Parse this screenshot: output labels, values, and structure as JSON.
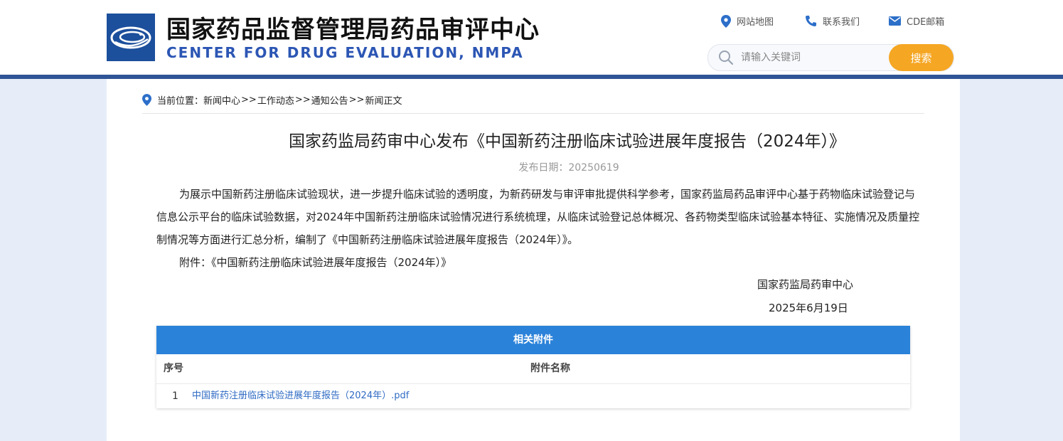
{
  "header": {
    "title_cn": "国家药品监督管理局药品审评中心",
    "title_en": "CENTER FOR DRUG EVALUATION, NMPA",
    "links": [
      {
        "label": "网站地图",
        "icon": "location-pin-icon"
      },
      {
        "label": "联系我们",
        "icon": "phone-icon"
      },
      {
        "label": "CDE邮箱",
        "icon": "mail-icon"
      }
    ],
    "search": {
      "placeholder": "请输入关键词",
      "button_label": "搜索"
    }
  },
  "breadcrumb": {
    "prefix": "当前位置：",
    "items": [
      "新闻中心",
      "工作动态",
      "通知公告",
      "新闻正文"
    ],
    "separator": ">>"
  },
  "article": {
    "title": "国家药监局药审中心发布《中国新药注册临床试验进展年度报告（2024年）》",
    "date": "发布日期：20250619",
    "paragraph": "为展示中国新药注册临床试验现状，进一步提升临床试验的透明度，为新药研发与审评审批提供科学参考，国家药监局药品审评中心基于药物临床试验登记与信息公示平台的临床试验数据，对2024年中国新药注册临床试验情况进行系统梳理，从临床试验登记总体概况、各药物类型临床试验基本特征、实施情况及质量控制情况等方面进行汇总分析，编制了《中国新药注册临床试验进展年度报告（2024年）》。",
    "attachment_line": "附件：《中国新药注册临床试验进展年度报告（2024年）》",
    "signature_org": "国家药监局药审中心",
    "signature_date": "2025年6月19日"
  },
  "attachments": {
    "heading": "相关附件",
    "col_no": "序号",
    "col_name": "附件名称",
    "rows": [
      {
        "no": "1",
        "name": "中国新药注册临床试验进展年度报告（2024年）.pdf"
      }
    ]
  },
  "colors": {
    "brand_blue": "#2f5597",
    "search_button": "#f5a623",
    "table_header": "#2b82d9",
    "link": "#2f6bc4"
  }
}
